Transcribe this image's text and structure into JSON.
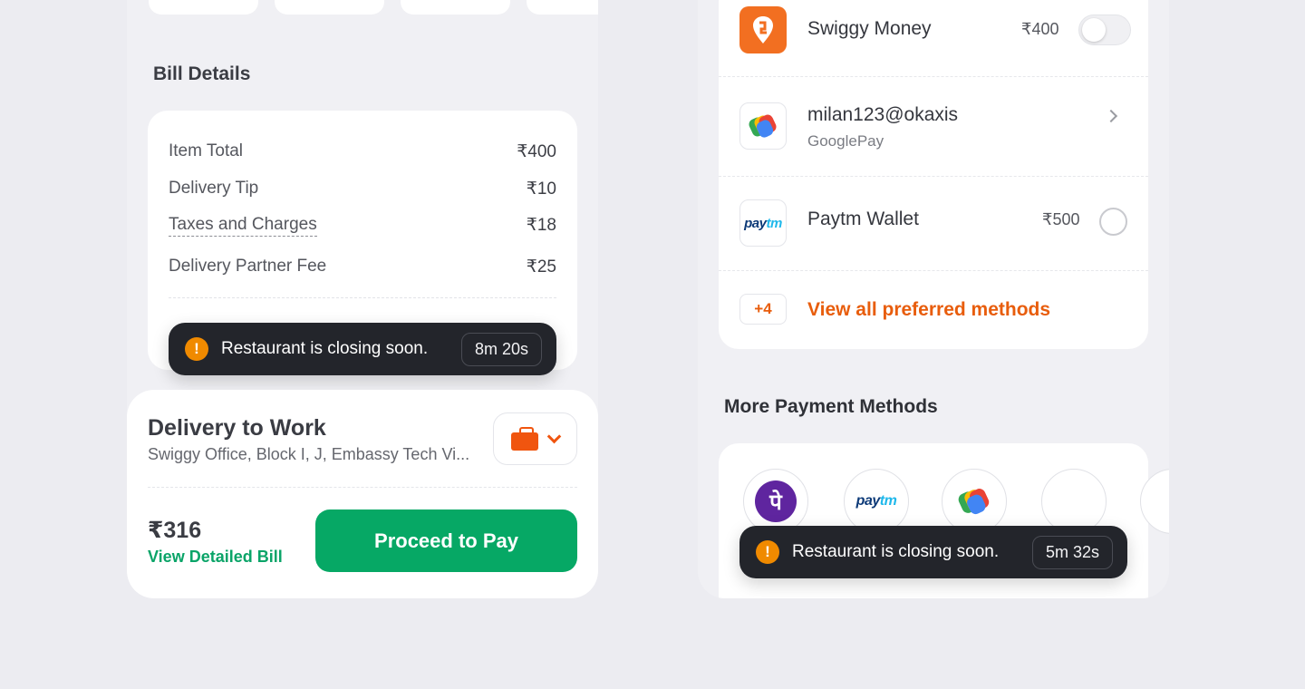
{
  "left_panel": {
    "bill": {
      "title": "Bill Details",
      "rows": [
        {
          "label": "Item Total",
          "amount": "₹400"
        },
        {
          "label": "Delivery Tip",
          "amount": "₹10"
        },
        {
          "label": "Taxes and Charges",
          "amount": "₹18"
        },
        {
          "label": "Delivery Partner Fee",
          "amount": "₹25"
        }
      ]
    },
    "toast": {
      "message": "Restaurant is closing soon.",
      "timer": "8m 20s",
      "icon": "!"
    },
    "delivery": {
      "title": "Delivery to Work",
      "address": "Swiggy Office, Block I, J, Embassy Tech Vi...",
      "address_icon": "briefcase-icon"
    },
    "footer": {
      "total": "₹316",
      "detail_link": "View Detailed Bill",
      "pay_button": "Proceed to Pay"
    }
  },
  "right_panel": {
    "preferred": [
      {
        "name": "Swiggy Money",
        "amount": "₹400",
        "control": "toggle",
        "toggle_on": false
      },
      {
        "name": "milan123@okaxis",
        "sub": "GooglePay",
        "control": "chevron"
      },
      {
        "name": "Paytm Wallet",
        "amount": "₹500",
        "control": "radio"
      }
    ],
    "view_all": {
      "badge": "+4",
      "label": "View all preferred methods"
    },
    "more": {
      "title": "More Payment Methods",
      "icons": [
        "phonepe-icon",
        "paytm-icon",
        "googlepay-icon",
        "empty-icon",
        "more-icon"
      ],
      "phonepe_glyph": "पे",
      "paytm_text_1": "pay",
      "paytm_text_2": "tm"
    },
    "toast": {
      "message": "Restaurant is closing soon.",
      "timer": "5m 32s",
      "icon": "!"
    }
  },
  "colors": {
    "accent_orange": "#e85d0c",
    "swiggy_orange": "#f26f21",
    "pay_green": "#06a865",
    "toast_bg": "#23252b",
    "warn": "#f08a00"
  }
}
